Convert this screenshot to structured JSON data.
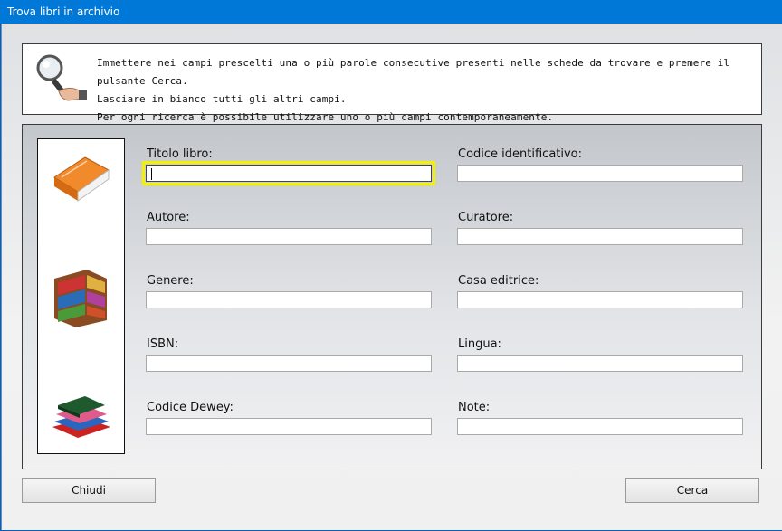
{
  "window": {
    "title": "Trova libri in archivio"
  },
  "info": {
    "lines": [
      "Immettere nei campi prescelti una o più parole consecutive presenti nelle schede da trovare e premere il pulsante Cerca.",
      "Lasciare in bianco tutti gli altri campi.",
      "Per ogni ricerca è possibile utilizzare uno o più campi contemporaneamente."
    ]
  },
  "fields": {
    "titolo": {
      "label": "Titolo libro:",
      "value": ""
    },
    "codice": {
      "label": "Codice identificativo:",
      "value": ""
    },
    "autore": {
      "label": "Autore:",
      "value": ""
    },
    "curatore": {
      "label": "Curatore:",
      "value": ""
    },
    "genere": {
      "label": "Genere:",
      "value": ""
    },
    "casa": {
      "label": "Casa editrice:",
      "value": ""
    },
    "isbn": {
      "label": "ISBN:",
      "value": ""
    },
    "lingua": {
      "label": "Lingua:",
      "value": ""
    },
    "dewey": {
      "label": "Codice Dewey:",
      "value": ""
    },
    "note": {
      "label": "Note:",
      "value": ""
    }
  },
  "buttons": {
    "close": "Chiudi",
    "search": "Cerca"
  },
  "colors": {
    "titlebar": "#0078d7",
    "focus_outline": "#f2f200"
  }
}
